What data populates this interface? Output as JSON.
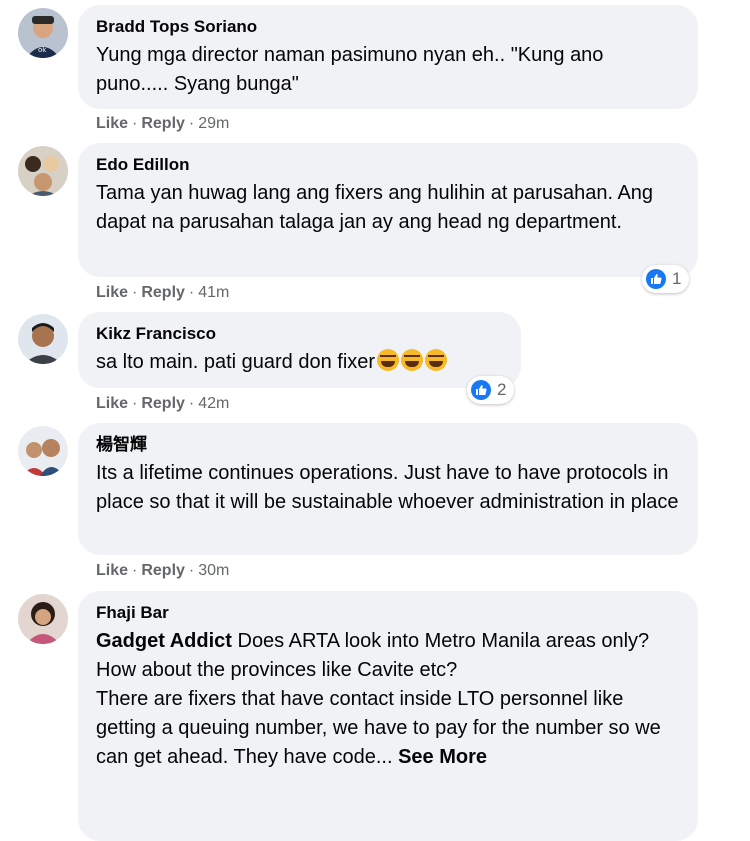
{
  "action_labels": {
    "like": "Like",
    "reply": "Reply"
  },
  "comments": [
    {
      "author": "Bradd Tops Soriano",
      "text": "Yung mga director naman pasimuno nyan eh.. \"Kung ano puno..... Syang bunga\"",
      "time": "29m"
    },
    {
      "author": "Edo Edillon",
      "text": "Tama yan huwag lang ang fixers ang hulihin at parusahan. Ang dapat na parusahan talaga jan ay ang head ng department.",
      "time": "41m",
      "reaction_count": "1"
    },
    {
      "author": "Kikz Francisco",
      "text": "sa lto main. pati guard don fixer",
      "emoji": "laughing-tears-emoji",
      "time": "42m",
      "reaction_count": "2"
    },
    {
      "author": "楊智輝",
      "text": "Its a lifetime continues operations. Just have to have protocols in place so that it will be sustainable whoever administration in place",
      "time": "30m"
    },
    {
      "author": "Fhaji Bar",
      "mention": "Gadget Addict",
      "text_line1": " Does ARTA look into Metro Manila areas only?",
      "text_line2": "How about the provinces like Cavite etc?",
      "text_line3": "There are fixers that have contact inside LTO personnel like getting a queuing number, we have to pay for the number so we can get ahead. They have code...",
      "see_more": "See More"
    }
  ],
  "colors": {
    "bubble": "#f0f2f5",
    "meta": "#65676b",
    "like_blue": "#1877f2",
    "text": "#050505"
  }
}
